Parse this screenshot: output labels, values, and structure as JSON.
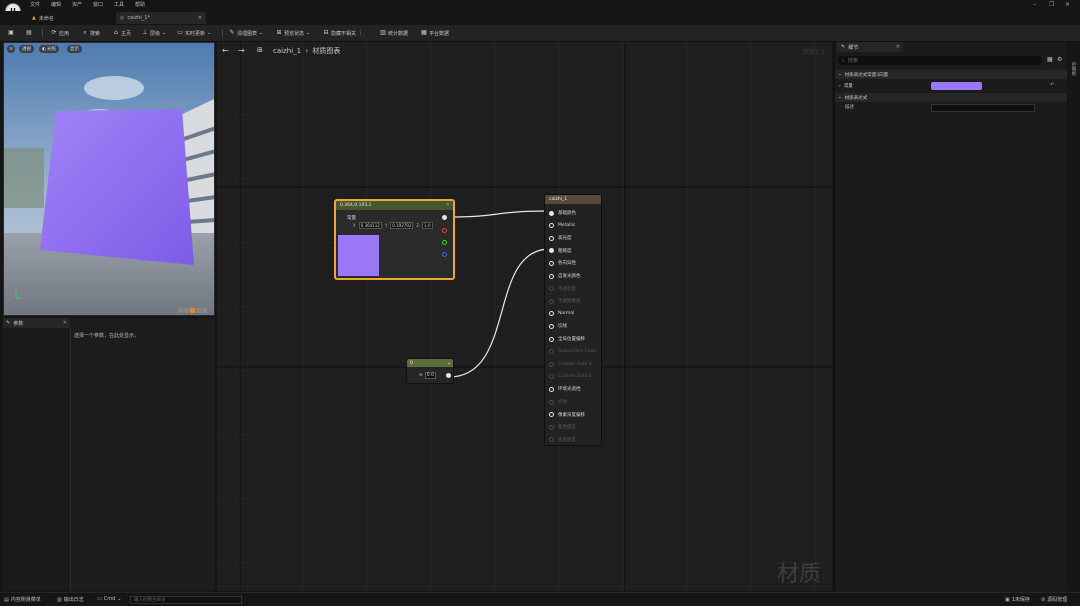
{
  "menu": {
    "items": [
      "文件",
      "编辑",
      "资产",
      "窗口",
      "工具",
      "帮助"
    ]
  },
  "tabs": [
    {
      "label": "未命名",
      "icon": "level-icon"
    },
    {
      "label": "caizhi_1*",
      "icon": "material-icon"
    }
  ],
  "toolbar": {
    "apply": "应用",
    "search": "搜索",
    "home": "主页",
    "hierarchy": "层级",
    "live_update": "实时更新",
    "clean_graph": "清理图表",
    "preview_state": "预览状态",
    "hide_unrelated": "隐藏不相关",
    "stats": "统计数据",
    "platform_stats": "平台数据"
  },
  "viewport": {
    "perspective": "透视",
    "lit": "光照",
    "show": "显示"
  },
  "params_panel": {
    "title": "参数",
    "message": "选择一个参数，在此处显示。"
  },
  "graph": {
    "breadcrumb": "caizhi_1",
    "breadcrumb_sub": "材质图表",
    "zoom": "缩放1:1",
    "watermark": "材质",
    "vector_node": {
      "title": "0.364,0.193,1",
      "label": "常量",
      "x": "0.364112",
      "y": "0.192792",
      "z": "1.0",
      "swatch_color": "#9a78f5"
    },
    "scalar_node": {
      "title": "0",
      "value": "0.0"
    },
    "result_node": {
      "title": "caizhi_1",
      "pins": [
        {
          "label": "基础颜色",
          "enabled": true,
          "connected": true
        },
        {
          "label": "Metallic",
          "enabled": true,
          "connected": false
        },
        {
          "label": "高光度",
          "enabled": true,
          "connected": false
        },
        {
          "label": "粗糙度",
          "enabled": true,
          "connected": true
        },
        {
          "label": "各向异性",
          "enabled": true,
          "connected": false
        },
        {
          "label": "自发光颜色",
          "enabled": true,
          "connected": false
        },
        {
          "label": "不透明度",
          "enabled": false,
          "connected": false
        },
        {
          "label": "不透明蒙版",
          "enabled": false,
          "connected": false
        },
        {
          "label": "Normal",
          "enabled": true,
          "connected": false
        },
        {
          "label": "切线",
          "enabled": true,
          "connected": false
        },
        {
          "label": "全局位置偏移",
          "enabled": true,
          "connected": false
        },
        {
          "label": "Subsurface Color",
          "enabled": false,
          "connected": false
        },
        {
          "label": "Custom Data 0",
          "enabled": false,
          "connected": false
        },
        {
          "label": "Custom Data 1",
          "enabled": false,
          "connected": false
        },
        {
          "label": "环境光遮挡",
          "enabled": true,
          "connected": false
        },
        {
          "label": "折射",
          "enabled": false,
          "connected": false
        },
        {
          "label": "像素深度偏移",
          "enabled": true,
          "connected": false
        },
        {
          "label": "着色模型",
          "enabled": false,
          "connected": false
        },
        {
          "label": "表面厚度",
          "enabled": false,
          "connected": false
        }
      ]
    }
  },
  "details": {
    "tab": "细节",
    "search_placeholder": "搜索",
    "section1": "材质表达式常量3向量",
    "vector_label": "常量",
    "vector_color": "#9a78f5",
    "section2": "材质表达式",
    "desc_label": "描述",
    "side_label": "控制板"
  },
  "statusbar": {
    "content_drawer": "内容侧滑菜单",
    "output_log": "输出日志",
    "cmd": "Cmd",
    "cmd_placeholder": "输入控制台命令",
    "unsaved": "1未保存",
    "source_control": "源码管理"
  }
}
